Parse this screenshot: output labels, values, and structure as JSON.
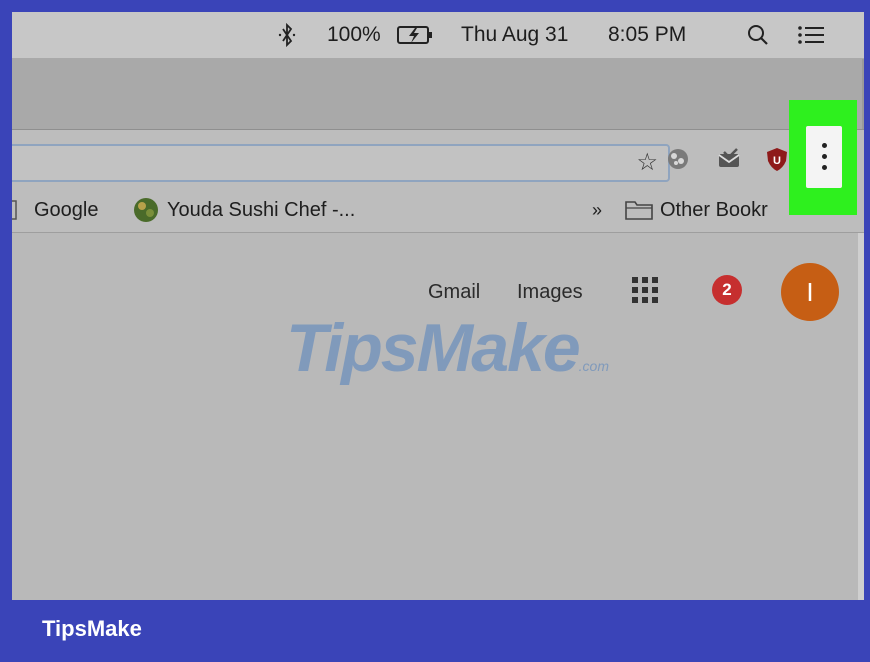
{
  "menubar": {
    "battery_percent": "100%",
    "date": "Thu Aug 31",
    "time": "8:05 PM"
  },
  "bookmarks_bar": {
    "items": [
      {
        "label": "Google"
      },
      {
        "label": "Youda Sushi Chef -..."
      }
    ],
    "overflow": "»",
    "other": "Other Bookr"
  },
  "google_bar": {
    "gmail": "Gmail",
    "images": "Images",
    "notifications": "2",
    "avatar_initial": "I"
  },
  "watermark": {
    "text": "TipsMake",
    "suffix": ".com"
  },
  "footer": {
    "brand": "TipsMake"
  },
  "colors": {
    "frame": "#3a44b8",
    "highlight": "#2ef01e",
    "avatar": "#c65e14",
    "notification": "#c62f2f"
  },
  "icons": [
    "bluetooth-icon",
    "battery-icon",
    "spotlight-search-icon",
    "notification-center-icon",
    "star-icon",
    "extension-icon",
    "mail-extension-icon",
    "ublock-icon",
    "more-menu-icon",
    "folder-icon",
    "apps-grid-icon"
  ]
}
